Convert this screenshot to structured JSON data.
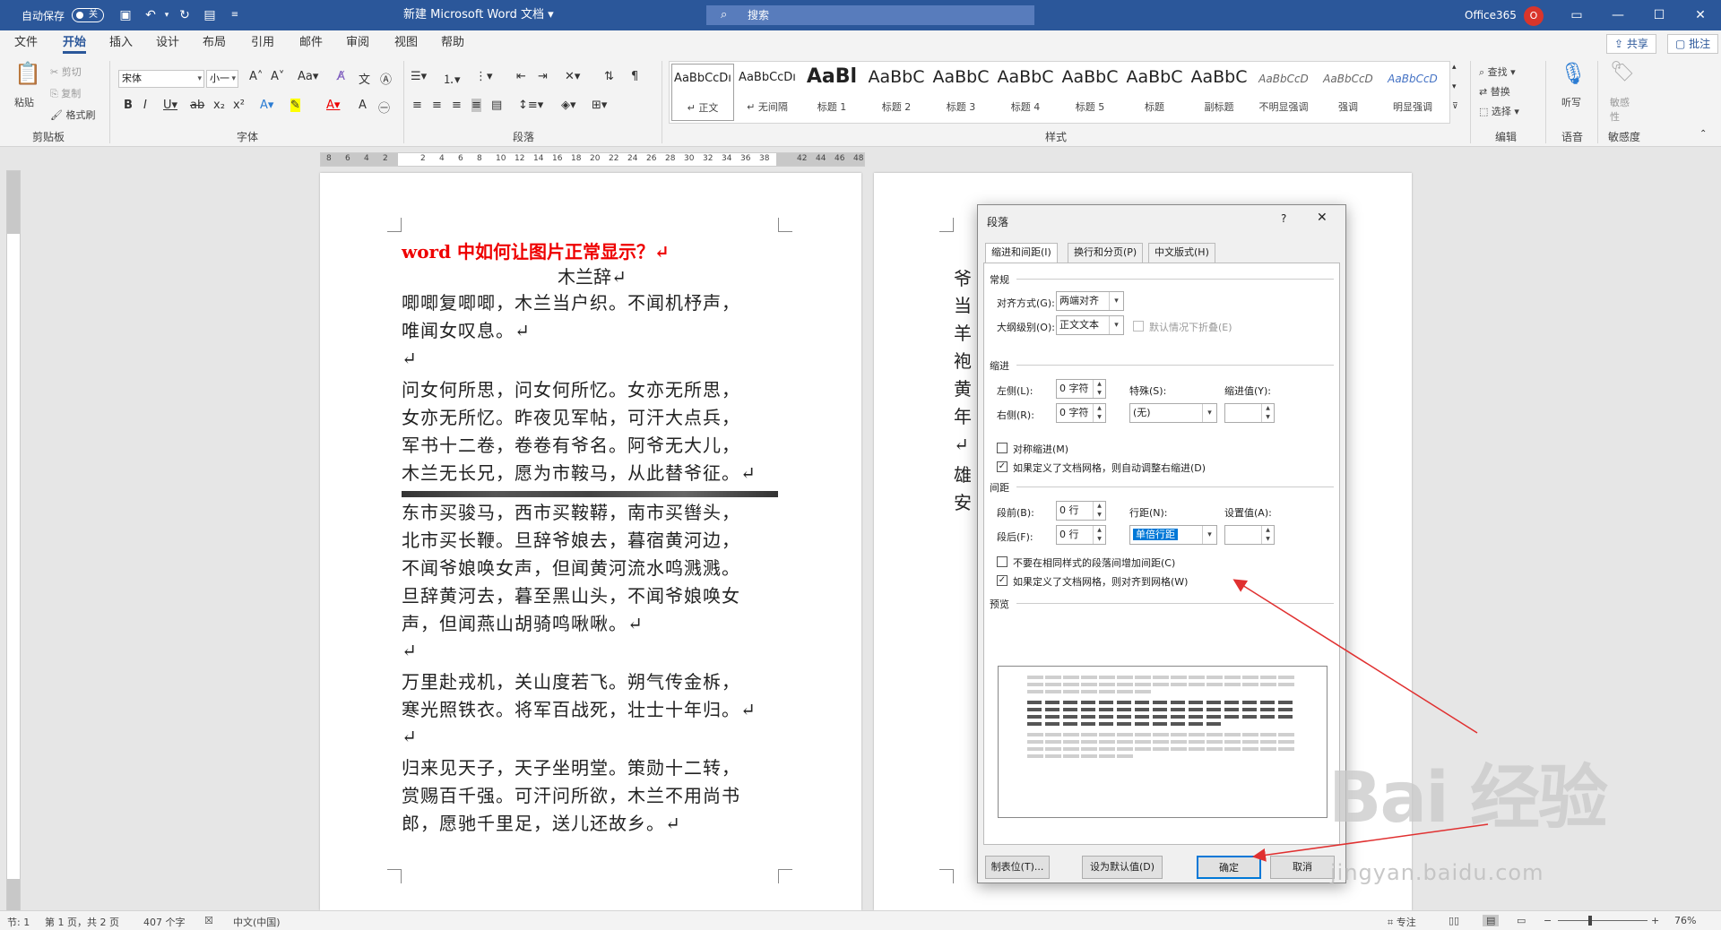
{
  "titlebar": {
    "autosave_label": "自动保存",
    "autosave_state": "关",
    "doc_title": "新建 Microsoft Word 文档 ▾",
    "search_placeholder": "搜索",
    "account": "Office365",
    "avatar_initial": "O",
    "accent_color": "#2b579a"
  },
  "tabs": [
    "文件",
    "开始",
    "插入",
    "设计",
    "布局",
    "引用",
    "邮件",
    "审阅",
    "视图",
    "帮助"
  ],
  "active_tab": "开始",
  "share_label": "共享",
  "comment_label": "批注",
  "ribbon": {
    "clipboard": {
      "paste": "粘贴",
      "cut": "剪切",
      "copy": "复制",
      "format_painter": "格式刷",
      "label": "剪贴板"
    },
    "font": {
      "name": "宋体",
      "size": "小一",
      "label": "字体"
    },
    "paragraph": {
      "label": "段落"
    },
    "styles": {
      "label": "样式",
      "items": [
        {
          "preview": "AaBbCcDı",
          "name": "↵ 正文",
          "kind": "normal"
        },
        {
          "preview": "AaBbCcDı",
          "name": "↵ 无间隔",
          "kind": "normal"
        },
        {
          "preview": "AaBl",
          "name": "标题 1",
          "kind": "big"
        },
        {
          "preview": "AaBbC",
          "name": "标题 2",
          "kind": "med"
        },
        {
          "preview": "AaBbC",
          "name": "标题 3",
          "kind": "med"
        },
        {
          "preview": "AaBbC",
          "name": "标题 4",
          "kind": "med"
        },
        {
          "preview": "AaBbC",
          "name": "标题 5",
          "kind": "med"
        },
        {
          "preview": "AaBbC",
          "name": "标题",
          "kind": "med"
        },
        {
          "preview": "AaBbC",
          "name": "副标题",
          "kind": "med"
        },
        {
          "preview": "AaBbCcD",
          "name": "不明显强调",
          "kind": "em"
        },
        {
          "preview": "AaBbCcD",
          "name": "强调",
          "kind": "em"
        },
        {
          "preview": "AaBbCcD",
          "name": "明显强调",
          "kind": "em-blue"
        }
      ]
    },
    "editing": {
      "find": "查找",
      "replace": "替换",
      "select": "选择",
      "label": "编辑"
    },
    "voice": {
      "dictate": "听写",
      "label": "语音"
    },
    "sensitivity": {
      "name": "敏感性",
      "label": "敏感度"
    }
  },
  "document": {
    "heading": "word 中如何让图片正常显示？↵",
    "subtitle": "木兰辞↵",
    "lines": [
      "唧唧复唧唧，木兰当户织。不闻机杼声，",
      "唯闻女叹息。↵",
      "↵",
      "问女何所思，问女何所忆。女亦无所思，",
      "女亦无所忆。昨夜见军帖，可汗大点兵，",
      "军书十二卷，卷卷有爷名。阿爷无大儿，",
      "木兰无长兄，愿为市鞍马，从此替爷征。↵",
      "东市买骏马，西市买鞍鞯，南市买辔头，",
      "北市买长鞭。旦辞爷娘去，暮宿黄河边，",
      "不闻爷娘唤女声，但闻黄河流水鸣溅溅。",
      "旦辞黄河去，暮至黑山头，不闻爷娘唤女",
      "声，但闻燕山胡骑鸣啾啾。↵",
      "↵",
      "万里赴戎机，关山度若飞。朔气传金柝，",
      "寒光照铁衣。将军百战死，壮士十年归。↵",
      "↵",
      "归来见天子，天子坐明堂。策勋十二转，",
      "赏赐百千强。可汗问所欲，木兰不用尚书",
      "郎，愿驰千里足，送儿还故乡。↵"
    ],
    "page2_chars": [
      "爷",
      "当",
      "羊",
      "袍",
      "黄",
      "年",
      "↵",
      "雄",
      "安"
    ]
  },
  "dialog": {
    "title": "段落",
    "help": "?",
    "tabs": [
      "缩进和间距(I)",
      "换行和分页(P)",
      "中文版式(H)"
    ],
    "general": {
      "section": "常规",
      "alignment_label": "对齐方式(G):",
      "alignment_value": "两端对齐",
      "outline_label": "大纲级别(O):",
      "outline_value": "正文文本",
      "collapse_label": "默认情况下折叠(E)"
    },
    "indent": {
      "section": "缩进",
      "left_label": "左侧(L):",
      "left_value": "0 字符",
      "right_label": "右侧(R):",
      "right_value": "0 字符",
      "special_label": "特殊(S):",
      "special_value": "(无)",
      "by_label": "缩进值(Y):",
      "mirror_label": "对称缩进(M)",
      "auto_adjust_label": "如果定义了文档网格，则自动调整右缩进(D)"
    },
    "spacing": {
      "section": "间距",
      "before_label": "段前(B):",
      "before_value": "0 行",
      "after_label": "段后(F):",
      "after_value": "0 行",
      "line_label": "行距(N):",
      "line_value": "单倍行距",
      "at_label": "设置值(A):",
      "no_space_label": "不要在相同样式的段落间增加间距(C)",
      "snap_grid_label": "如果定义了文档网格，则对齐到网格(W)"
    },
    "preview_section": "预览",
    "buttons": {
      "tabs": "制表位(T)...",
      "default": "设为默认值(D)",
      "ok": "确定",
      "cancel": "取消"
    }
  },
  "statusbar": {
    "section": "节: 1",
    "page": "第 1 页，共 2 页",
    "words": "407 个字",
    "language": "中文(中国)",
    "focus": "专注",
    "zoom": "76%"
  },
  "watermark": {
    "brand": "Bai  经验",
    "url": "jingyan.baidu.com"
  }
}
